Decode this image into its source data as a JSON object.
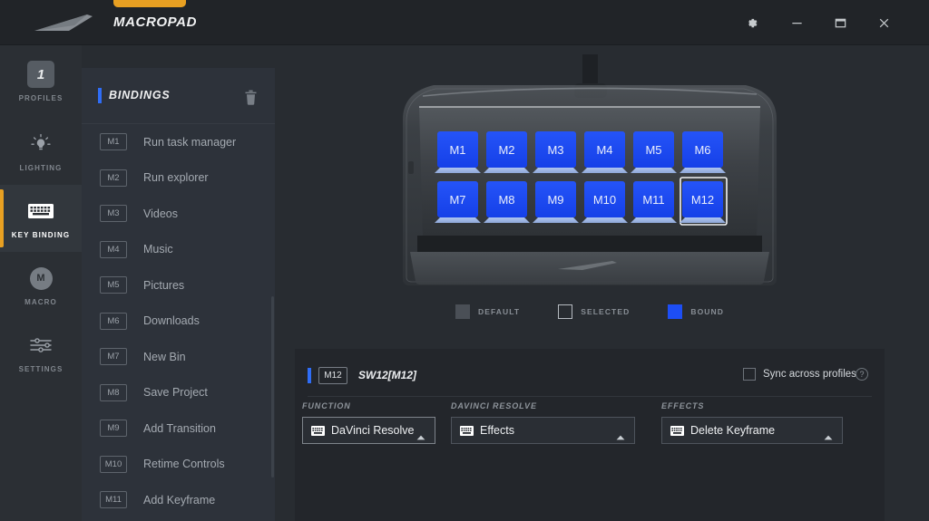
{
  "window": {
    "brand_title": "MACROPAD",
    "logo_icon": "wing-logo",
    "controls": [
      {
        "name": "settings-button",
        "icon": "gear-icon"
      },
      {
        "name": "minimize-button",
        "icon": "minimize-icon"
      },
      {
        "name": "maximize-button",
        "icon": "maximize-icon"
      },
      {
        "name": "close-button",
        "icon": "close-icon"
      }
    ]
  },
  "sidebar": {
    "items": [
      {
        "label": "PROFILES",
        "icon": "profile-number-badge",
        "badge": "1",
        "active": false
      },
      {
        "label": "LIGHTING",
        "icon": "lightbulb-icon",
        "active": false
      },
      {
        "label": "KEY BINDING",
        "icon": "keyboard-icon",
        "active": true
      },
      {
        "label": "MACRO",
        "icon": "macro-m-icon",
        "badge": "M",
        "active": false
      },
      {
        "label": "SETTINGS",
        "icon": "sliders-icon",
        "active": false
      }
    ]
  },
  "bindings": {
    "title": "BINDINGS",
    "delete_icon": "trash-icon",
    "rows": [
      {
        "key": "M1",
        "name": "Run task manager"
      },
      {
        "key": "M2",
        "name": "Run explorer"
      },
      {
        "key": "M3",
        "name": "Videos"
      },
      {
        "key": "M4",
        "name": "Music"
      },
      {
        "key": "M5",
        "name": "Pictures"
      },
      {
        "key": "M6",
        "name": "Downloads"
      },
      {
        "key": "M7",
        "name": "New Bin"
      },
      {
        "key": "M8",
        "name": "Save Project"
      },
      {
        "key": "M9",
        "name": "Add Transition"
      },
      {
        "key": "M10",
        "name": "Retime Controls"
      },
      {
        "key": "M11",
        "name": "Add Keyframe"
      }
    ]
  },
  "device": {
    "keys_row1": [
      "M1",
      "M2",
      "M3",
      "M4",
      "M5",
      "M6"
    ],
    "keys_row2": [
      "M7",
      "M8",
      "M9",
      "M10",
      "M11",
      "M12"
    ],
    "selected_key": "M12",
    "key_bound_color": "#1d4ef5"
  },
  "legend": {
    "items": [
      {
        "label": "DEFAULT",
        "swatch": "default",
        "color": "#4a4f56"
      },
      {
        "label": "SELECTED",
        "swatch": "selected",
        "color": "#b6bbc1"
      },
      {
        "label": "BOUND",
        "swatch": "bound",
        "color": "#1d4ef5"
      }
    ]
  },
  "config": {
    "key_chip": "M12",
    "title": "SW12[M12]",
    "sync_label": "Sync across profiles",
    "sync_checked": false,
    "help_icon": "question-mark-icon",
    "fields": [
      {
        "label": "FUNCTION",
        "value": "DaVinci Resolve",
        "icon": "keyboard-icon",
        "active": true
      },
      {
        "label": "DAVINCI RESOLVE",
        "value": "Effects",
        "icon": "keyboard-icon",
        "active": false
      },
      {
        "label": "EFFECTS",
        "value": "Delete Keyframe",
        "icon": "keyboard-icon",
        "active": false
      }
    ]
  },
  "colors": {
    "background": "#282c31",
    "panel": "#2d323a",
    "titlebar": "#212428",
    "accent_orange": "#e8a022",
    "accent_blue": "#2f6df6",
    "key_blue": "#1d4ef5"
  }
}
